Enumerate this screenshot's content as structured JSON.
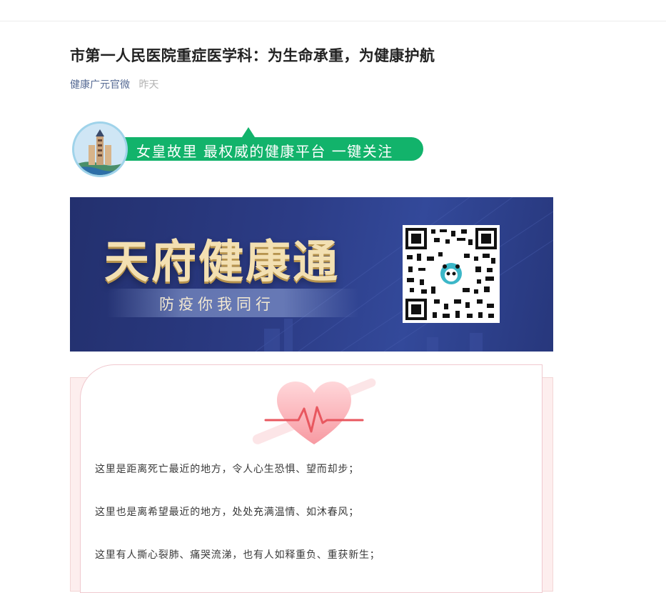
{
  "article": {
    "title": "市第一人民医院重症医学科：为生命承重，为健康护航",
    "author": "健康广元官微",
    "date": "昨天"
  },
  "follow_banner": {
    "text": "女皇故里  最权威的健康平台  一键关注",
    "color": "#12b36b"
  },
  "promo_banner": {
    "title": "天府健康通",
    "subtitle": "防疫你我同行"
  },
  "content": {
    "paragraphs": [
      "这里是距离死亡最近的地方，令人心生恐惧、望而却步；",
      "这里也是离希望最近的地方，处处充满温情、如沐春风；",
      "这里有人撕心裂肺、痛哭流涕，也有人如释重负、重获新生；"
    ]
  }
}
